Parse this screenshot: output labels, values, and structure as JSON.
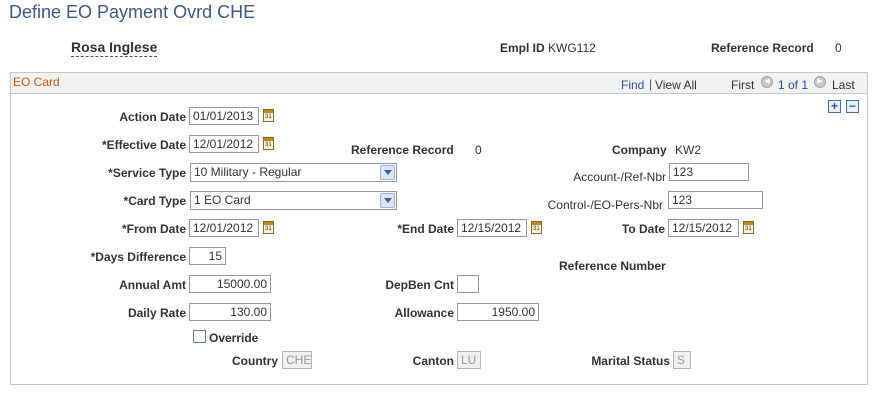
{
  "page": {
    "title": "Define EO Payment Ovrd CHE"
  },
  "employee": {
    "name": "Rosa Inglese",
    "empl_id_label": "Empl ID",
    "empl_id": "KWG112",
    "ref_record_label": "Reference Record",
    "ref_record": "0"
  },
  "card": {
    "title": "EO Card",
    "nav": {
      "find": "Find",
      "separator": "|",
      "view_all": "View All",
      "first": "First",
      "count": "1 of 1",
      "last": "Last"
    }
  },
  "form": {
    "action_date": {
      "label": "Action Date",
      "value": "01/01/2013"
    },
    "effective_date": {
      "label": "*Effective Date",
      "value": "12/01/2012"
    },
    "ref_record": {
      "label": "Reference Record",
      "value": "0"
    },
    "company": {
      "label": "Company",
      "value": "KW2"
    },
    "service_type": {
      "label": "*Service Type",
      "value": "10 Military - Regular"
    },
    "account_ref_nbr": {
      "label": "Account-/Ref-Nbr",
      "value": "123"
    },
    "card_type": {
      "label": "*Card Type",
      "value": "1 EO Card"
    },
    "control_eo_pers_nbr": {
      "label": "Control-/EO-Pers-Nbr",
      "value": "123"
    },
    "from_date": {
      "label": "*From Date",
      "value": "12/01/2012"
    },
    "end_date": {
      "label": "*End Date",
      "value": "12/15/2012"
    },
    "to_date": {
      "label": "To Date",
      "value": "12/15/2012"
    },
    "days_difference": {
      "label": "*Days Difference",
      "value": "15"
    },
    "reference_number": {
      "label": "Reference Number"
    },
    "annual_amt": {
      "label": "Annual Amt",
      "value": "15000.00"
    },
    "depben_cnt": {
      "label": "DepBen Cnt",
      "value": ""
    },
    "daily_rate": {
      "label": "Daily Rate",
      "value": "130.00"
    },
    "allowance": {
      "label": "Allowance",
      "value": "1950.00"
    },
    "override": {
      "label": "Override",
      "checked": false
    },
    "country": {
      "label": "Country",
      "value": "CHE"
    },
    "canton": {
      "label": "Canton",
      "value": "LU"
    },
    "marital_status": {
      "label": "Marital Status",
      "value": "S"
    }
  },
  "icons": {
    "calendar": "calendar-icon",
    "prev": "previous-arrow-icon",
    "next": "next-arrow-icon",
    "add": "plus-icon",
    "remove": "minus-icon",
    "dropdown": "chevron-down-icon"
  }
}
